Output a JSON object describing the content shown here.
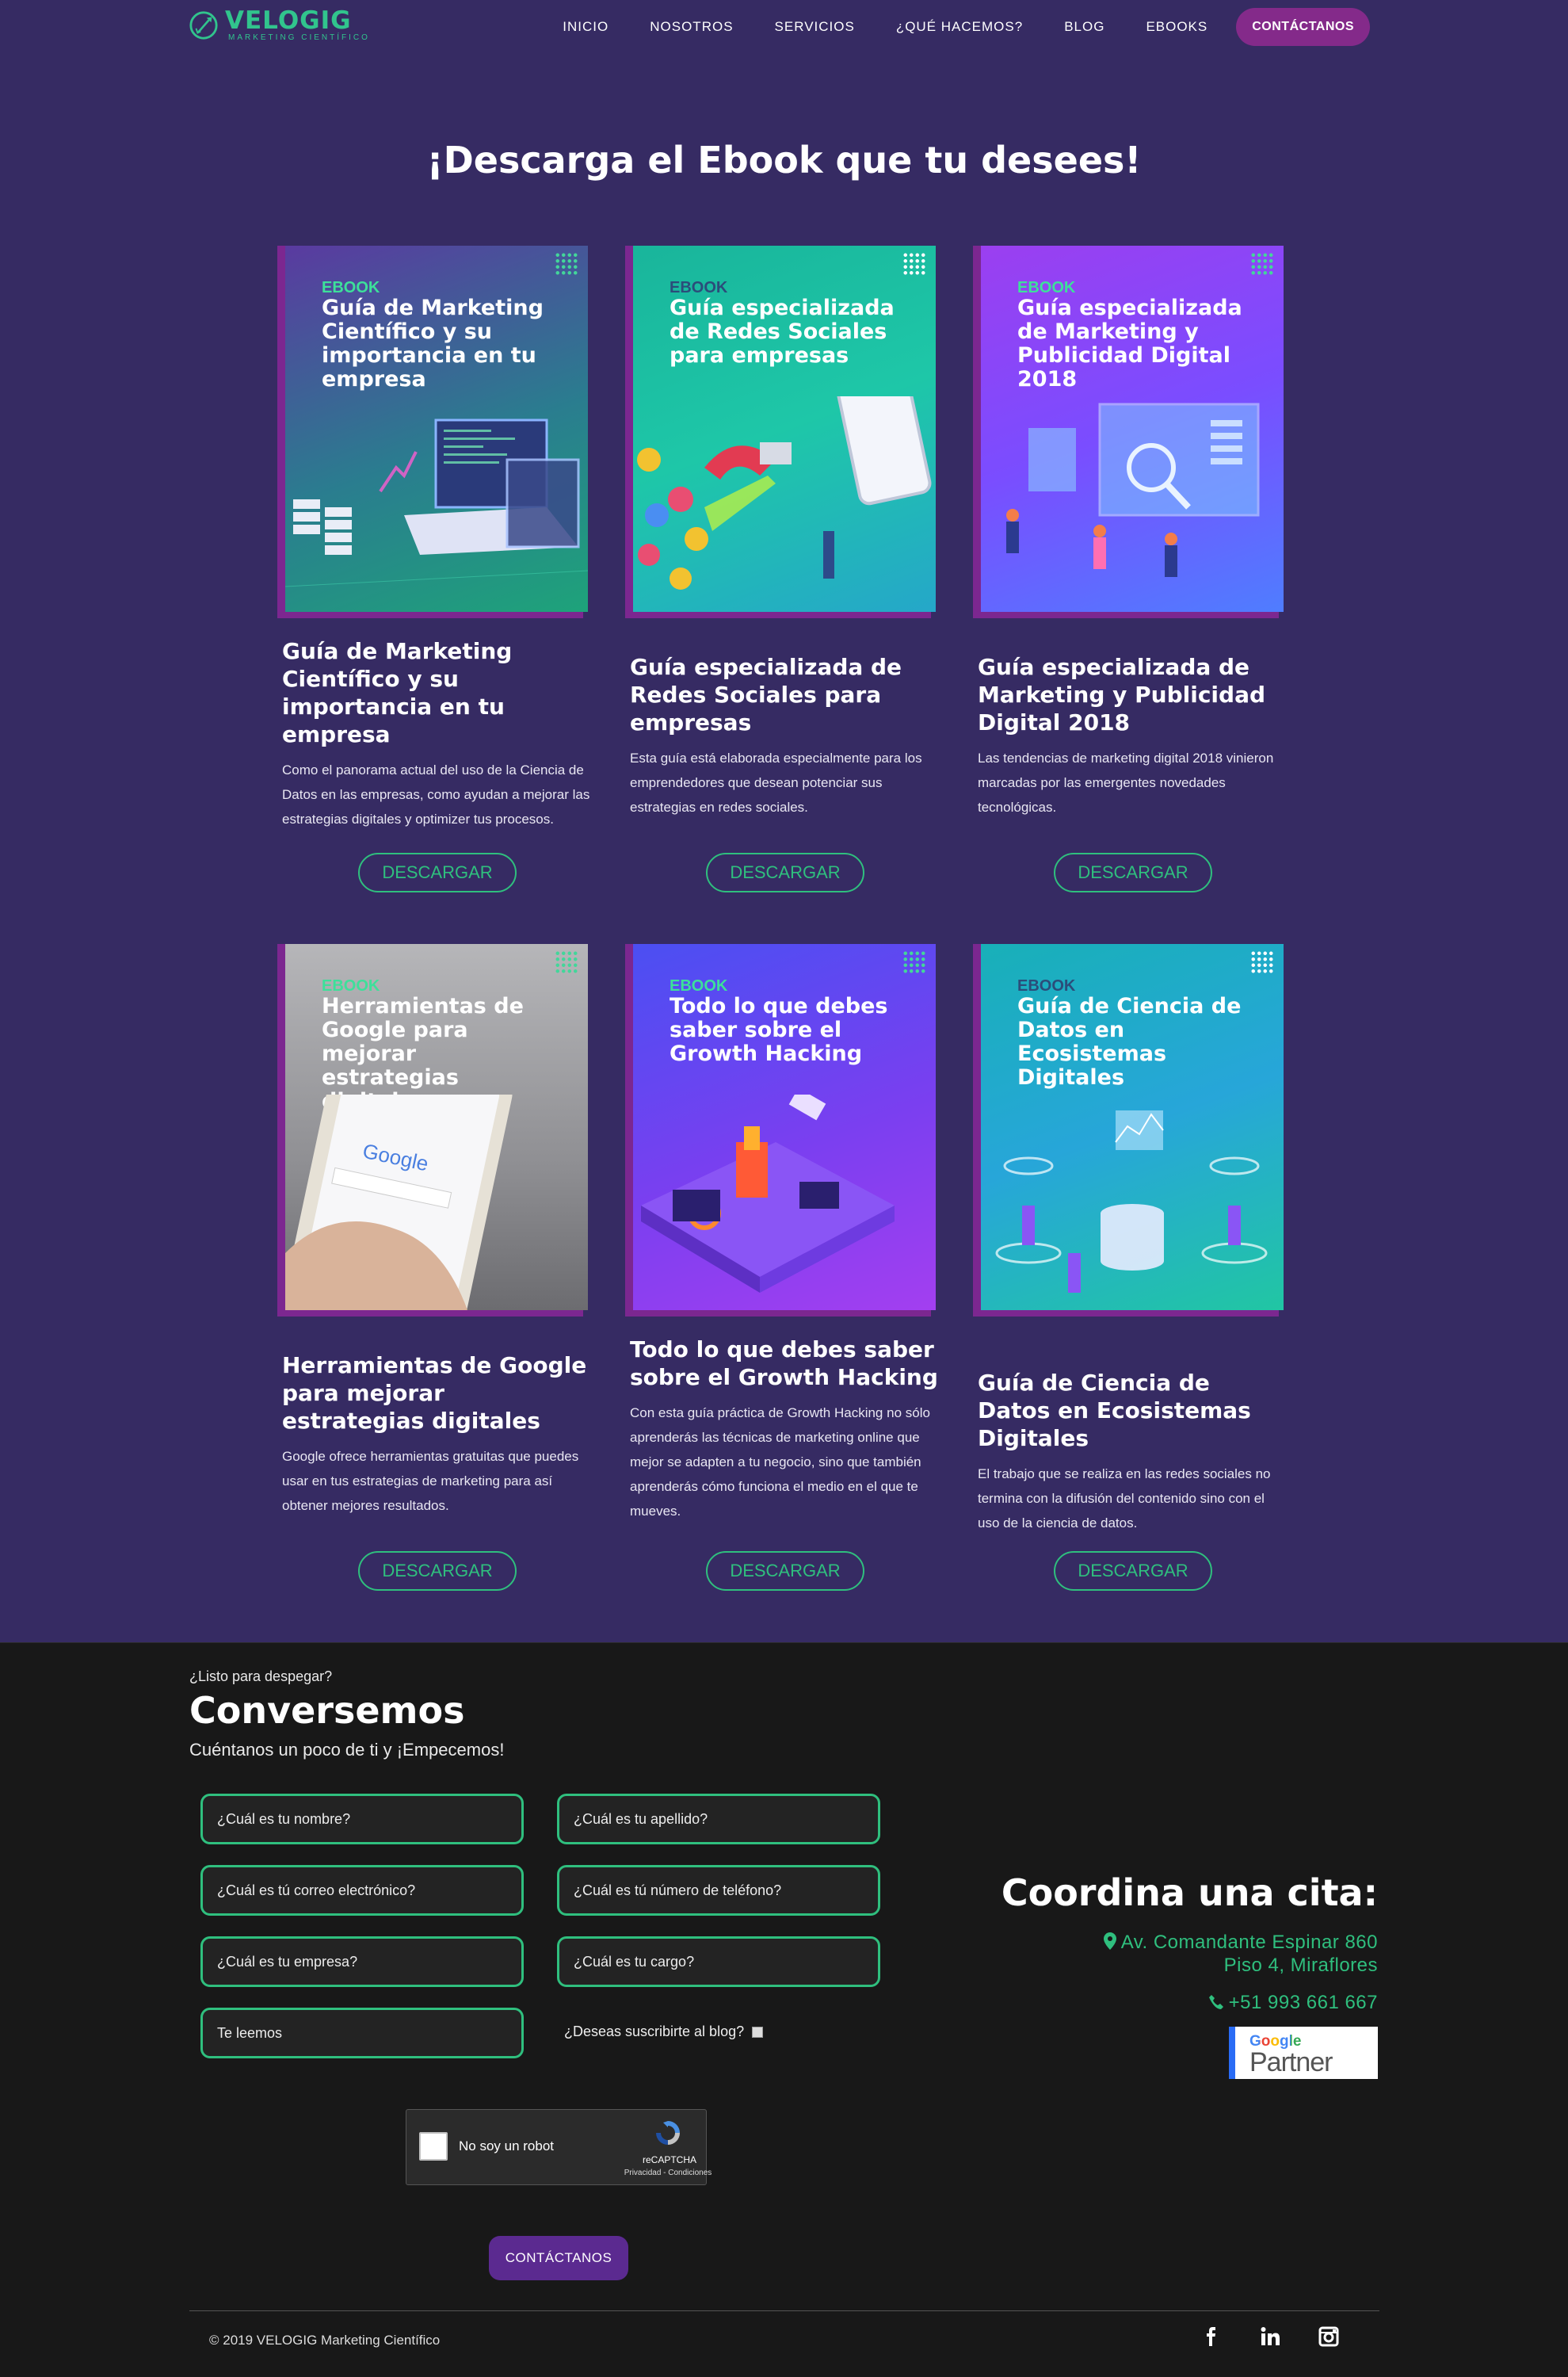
{
  "nav": {
    "logo_name": "VELOGIG",
    "logo_sub": "MARKETING CIENTÍFICO",
    "items": [
      "INICIO",
      "NOSOTROS",
      "SERVICIOS",
      "¿QUÉ HACEMOS?",
      "BLOG",
      "EBOOKS"
    ],
    "cta": "CONTÁCTANOS"
  },
  "main": {
    "title": "¡Descarga el Ebook que tu desees!",
    "download_label": "DESCARGAR",
    "ebooks": [
      {
        "cover_tag": "EBOOK",
        "cover_title": "Guía de Marketing Científico y su importancia en tu empresa",
        "title": "Guía de Marketing Científico y su importancia en tu empresa",
        "description": "Como el panorama actual del uso de la Ciencia de Datos en las empresas, como ayudan a mejorar las estrategias digitales y optimizer tus procesos."
      },
      {
        "cover_tag": "EBOOK",
        "cover_title": "Guía especializada de Redes Sociales para empresas",
        "title": "Guía especializada de Redes Sociales para empresas",
        "description": "Esta guía está elaborada especialmente para los emprendedores que desean potenciar sus estrategias en redes sociales."
      },
      {
        "cover_tag": "EBOOK",
        "cover_title": "Guía especializada de Marketing y Publicidad Digital 2018",
        "title": "Guía especializada de Marketing y Publicidad Digital 2018",
        "description": "Las tendencias de marketing digital 2018 vinieron marcadas por las emergentes novedades tecnológicas."
      },
      {
        "cover_tag": "EBOOK",
        "cover_title": "Herramientas de Google para mejorar estrategias digitales",
        "title": "Herramientas de Google para mejorar estrategias digitales",
        "description": "Google ofrece herramientas gratuitas que puedes usar en tus estrategias de marketing para así obtener mejores resultados."
      },
      {
        "cover_tag": "EBOOK",
        "cover_title": "Todo lo que debes saber sobre el Growth Hacking",
        "title": "Todo lo que debes saber sobre el Growth Hacking",
        "description": "Con esta guía práctica de Growth Hacking no sólo aprenderás las técnicas de marketing online que mejor se adapten a tu negocio, sino que también aprenderás cómo funciona el medio en el que te mueves."
      },
      {
        "cover_tag": "EBOOK",
        "cover_title": "Guía de Ciencia de Datos en Ecosistemas Digitales",
        "title": "Guía de Ciencia de Datos en Ecosistemas Digitales",
        "description": "El trabajo que se realiza en las redes sociales no termina con la difusión del contenido sino con el uso de la ciencia de datos."
      }
    ]
  },
  "contact": {
    "kicker": "¿Listo para despegar?",
    "title": "Conversemos",
    "subtitle": "Cuéntanos un poco de ti y ¡Empecemos!",
    "fields": {
      "first_name": "¿Cuál es tu nombre?",
      "last_name": "¿Cuál es tu apellido?",
      "email": "¿Cuál es tú correo electrónico?",
      "phone": "¿Cuál es tú número de teléfono?",
      "company": "¿Cuál es tu empresa?",
      "position": "¿Cuál es tu cargo?",
      "message": "Te leemos"
    },
    "subscribe_label": "¿Deseas suscribirte al blog?",
    "captcha": {
      "label": "No soy un robot",
      "brand": "reCAPTCHA",
      "legal": "Privacidad - Condiciones"
    },
    "submit": "CONTÁCTANOS"
  },
  "cita": {
    "title": "Coordina una cita:",
    "address_1": "Av. Comandante Espinar 860",
    "address_2": "Piso 4, Miraflores",
    "phone": "+51 993 661 667",
    "partner_brand": "Google",
    "partner_label": "Partner"
  },
  "footer": {
    "copyright": "© 2019 VELOGIG Marketing Científico"
  },
  "colors": {
    "background": "#362b63",
    "accent_green": "#2fbf7e",
    "accent_magenta": "#842a8a",
    "footer_bg": "#181818"
  }
}
